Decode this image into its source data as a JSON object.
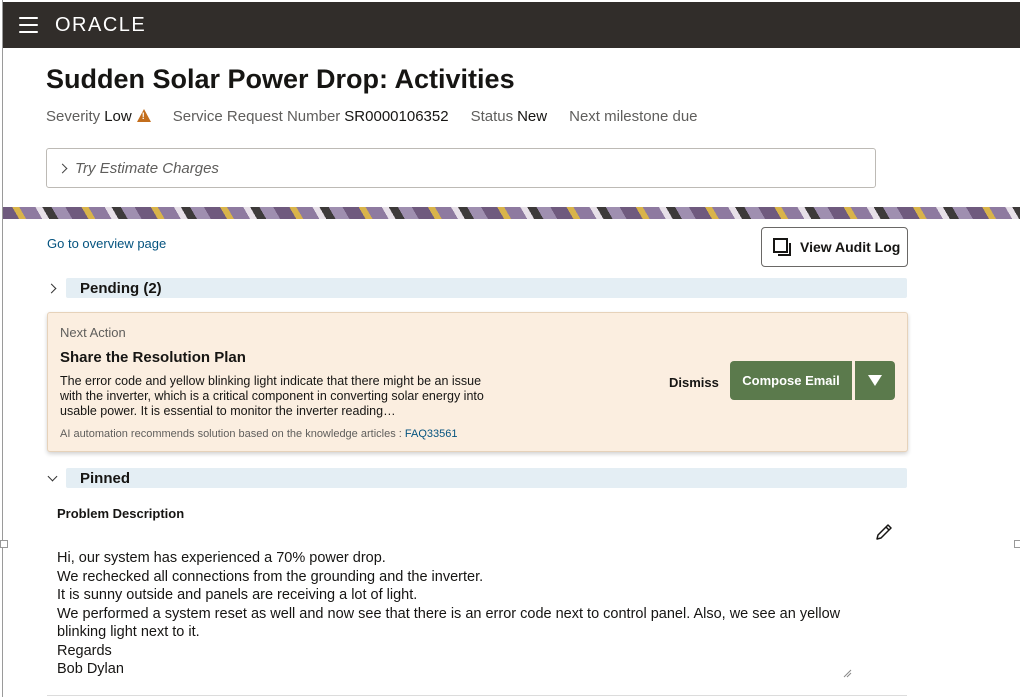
{
  "header": {
    "logo": "ORACLE"
  },
  "page": {
    "title": "Sudden Solar Power Drop: Activities",
    "meta": {
      "severity_label": "Severity",
      "severity_value": "Low",
      "sr_label": "Service Request Number",
      "sr_value": "SR0000106352",
      "status_label": "Status",
      "status_value": "New",
      "milestone_label": "Next milestone due"
    },
    "estimate_label": "Try Estimate Charges",
    "overview_link": "Go to overview page",
    "audit_button": "View Audit Log"
  },
  "sections": {
    "pending": "Pending (2)",
    "pinned": "Pinned"
  },
  "next_action": {
    "label": "Next Action",
    "title": "Share the Resolution Plan",
    "description": "The error code and yellow blinking light indicate that there might be an issue with the inverter, which is a critical component in converting solar energy into usable power. It is essential to monitor the inverter reading…",
    "footer_text": "AI automation recommends solution based on the knowledge articles :",
    "footer_link": "FAQ33561",
    "dismiss": "Dismiss",
    "compose": "Compose Email"
  },
  "pinned": {
    "label": "Problem Description",
    "text": "Hi, our system has experienced a 70% power drop.\nWe rechecked all connections from the grounding and the inverter.\nIt is sunny outside and panels are receiving a lot of light.\nWe performed a system reset as well and now see that there is an error code next to control panel. Also, we see an yellow blinking light next to it.\n Regards\n Bob Dylan"
  },
  "colors": {
    "topbar": "#312d2a",
    "accent_green": "#5b7a4c",
    "card_bg": "#fbeee0",
    "link": "#04537f",
    "warning": "#c36e1c"
  }
}
